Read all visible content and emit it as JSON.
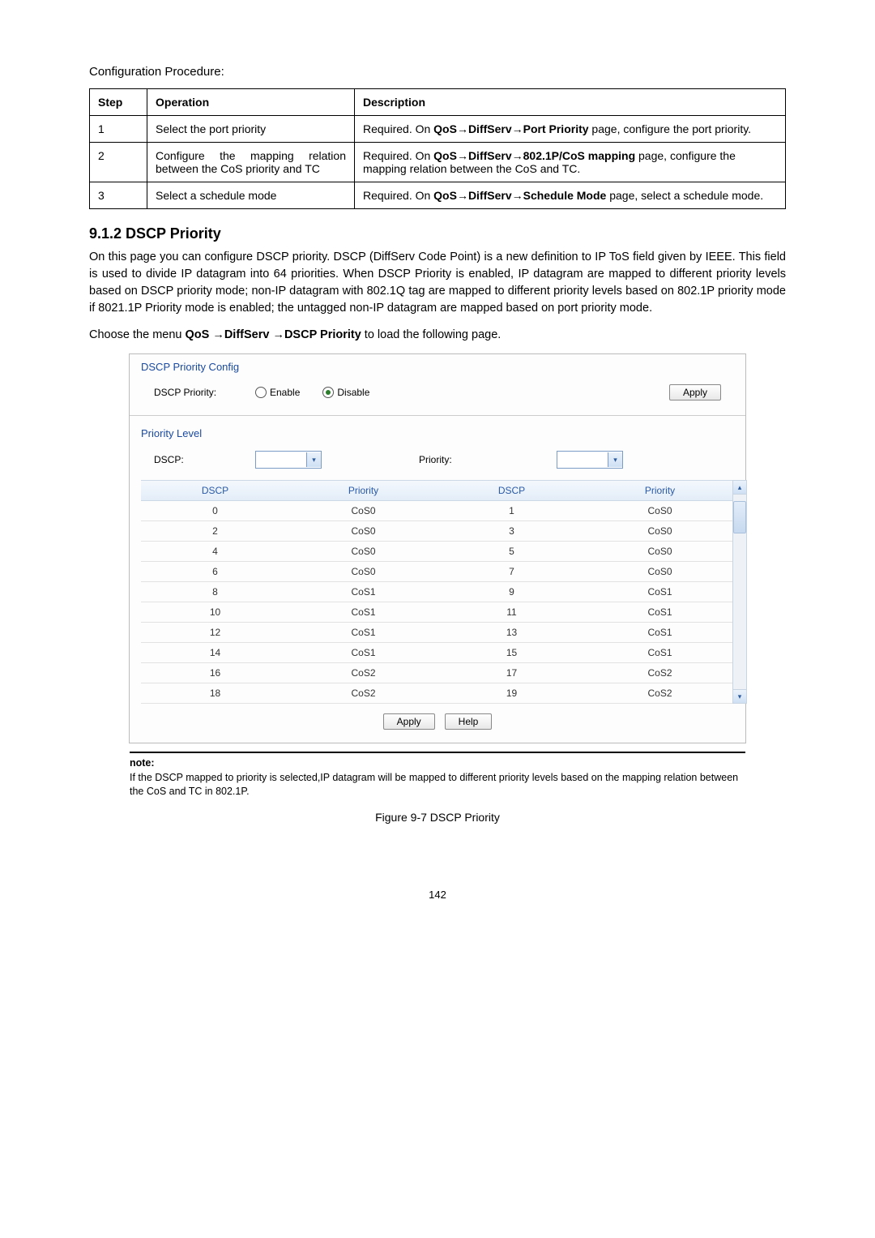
{
  "intro_title": "Configuration Procedure:",
  "proc_table": {
    "headers": {
      "step": "Step",
      "op": "Operation",
      "desc": "Description"
    },
    "rows": [
      {
        "step": "1",
        "op": "Select the port priority",
        "desc_before": "Required. On ",
        "desc_bold": "QoS→DiffServ→Port Priority",
        "desc_after": " page, configure the port priority."
      },
      {
        "step": "2",
        "op": "Configure the mapping relation between the CoS priority and TC",
        "desc_before": "Required. On ",
        "desc_bold": "QoS→DiffServ→802.1P/CoS mapping",
        "desc_after": " page, configure the mapping relation between the CoS and TC."
      },
      {
        "step": "3",
        "op": "Select a schedule mode",
        "desc_before": "Required. On ",
        "desc_bold": "QoS→DiffServ→Schedule Mode",
        "desc_after": " page, select a schedule mode."
      }
    ]
  },
  "heading_9_1_2": "9.1.2 DSCP Priority",
  "para1": "On this page you can configure DSCP priority. DSCP (DiffServ Code Point) is a new definition to IP ToS field given by IEEE. This field is used to divide IP datagram into 64 priorities. When DSCP Priority is enabled, IP datagram are mapped to different priority levels based on DSCP priority mode; non-IP datagram with 802.1Q tag are mapped to different priority levels based on 802.1P priority mode if 8021.1P Priority mode is enabled; the untagged non-IP datagram are mapped based on port priority mode.",
  "para2_before": "Choose the menu ",
  "para2_bold": "QoS →DiffServ →DSCP Priority",
  "para2_after": " to load the following page.",
  "screenshot_data": {
    "config_title": "DSCP Priority Config",
    "dscp_priority_label": "DSCP Priority:",
    "enable_label": "Enable",
    "disable_label": "Disable",
    "apply_label": "Apply",
    "level_title": "Priority Level",
    "dscp_label": "DSCP:",
    "priority_label": "Priority:",
    "cols": {
      "dscp": "DSCP",
      "priority": "Priority"
    },
    "rows": [
      {
        "d1": "0",
        "p1": "CoS0",
        "d2": "1",
        "p2": "CoS0"
      },
      {
        "d1": "2",
        "p1": "CoS0",
        "d2": "3",
        "p2": "CoS0"
      },
      {
        "d1": "4",
        "p1": "CoS0",
        "d2": "5",
        "p2": "CoS0"
      },
      {
        "d1": "6",
        "p1": "CoS0",
        "d2": "7",
        "p2": "CoS0"
      },
      {
        "d1": "8",
        "p1": "CoS1",
        "d2": "9",
        "p2": "CoS1"
      },
      {
        "d1": "10",
        "p1": "CoS1",
        "d2": "11",
        "p2": "CoS1"
      },
      {
        "d1": "12",
        "p1": "CoS1",
        "d2": "13",
        "p2": "CoS1"
      },
      {
        "d1": "14",
        "p1": "CoS1",
        "d2": "15",
        "p2": "CoS1"
      },
      {
        "d1": "16",
        "p1": "CoS2",
        "d2": "17",
        "p2": "CoS2"
      },
      {
        "d1": "18",
        "p1": "CoS2",
        "d2": "19",
        "p2": "CoS2"
      }
    ],
    "help_label": "Help"
  },
  "note": {
    "label": "note:",
    "text": "If the DSCP mapped to priority is selected,IP datagram will be mapped to different priority levels based on the mapping relation between the CoS and TC in 802.1P."
  },
  "figure_caption": "Figure 9-7 DSCP Priority",
  "page_number": "142"
}
